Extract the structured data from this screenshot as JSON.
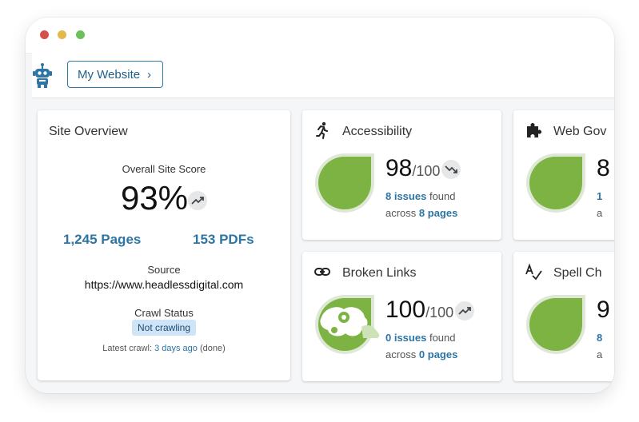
{
  "header": {
    "site_button": "My Website"
  },
  "overview": {
    "title": "Site Overview",
    "score_label": "Overall Site Score",
    "score": "93%",
    "pages": "1,245 Pages",
    "pdfs": "153 PDFs",
    "source_label": "Source",
    "source_url": "https://www.headlessdigital.com",
    "crawl_status_label": "Crawl Status",
    "crawl_status": "Not crawling",
    "latest_prefix": "Latest crawl:",
    "latest_link": "3 days ago",
    "latest_suffix": "(done)"
  },
  "cards": {
    "accessibility": {
      "title": "Accessibility",
      "score": "98",
      "max": "/100",
      "issues": "8 issues",
      "found": "found",
      "across": "across",
      "pages": "8 pages",
      "trend": "down"
    },
    "web_governance": {
      "title": "Web Gov",
      "score": "8",
      "issues": "1",
      "across": "a"
    },
    "broken_links": {
      "title": "Broken Links",
      "score": "100",
      "max": "/100",
      "issues": "0 issues",
      "found": "found",
      "across": "across",
      "pages": "0 pages",
      "trend": "up"
    },
    "spell_check": {
      "title": "Spell Ch",
      "score": "9",
      "issues": "8",
      "across": "a"
    }
  },
  "colors": {
    "accent": "#2d75a4",
    "green": "#7cb342",
    "border": "#2d7aa6"
  }
}
